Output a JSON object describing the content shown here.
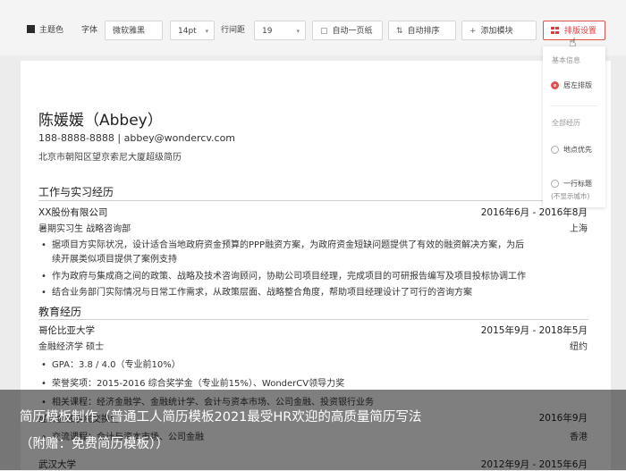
{
  "toolbar": {
    "theme_color": "主题色",
    "font_label": "字体",
    "font_value": "微软雅黑",
    "size_value": "14pt",
    "spacing_label": "行间距",
    "spacing_value": "19",
    "auto_page": "自动一页纸",
    "auto_sort": "自动排序",
    "add_module": "添加模块",
    "layout_settings": "排版设置"
  },
  "layout_panel": {
    "basic_info": "基本信息",
    "left_align": "居左排版",
    "all_experience": "全部经历",
    "location_first": "地点优先",
    "one_line_title": "一行标题",
    "not_show_city": "(不显示城市)"
  },
  "resume": {
    "name": "陈媛媛（Abbey）",
    "contact": "188-8888-8888 | abbey@wondercv.com",
    "address": "北京市朝阳区望京索尼大厦超级简历",
    "work_section": "工作与实习经历",
    "work": {
      "company": "XX股份有限公司",
      "date": "2016年6月 - 2016年8月",
      "role": "暑期实习生  战略咨询部",
      "city": "上海",
      "bullets": [
        "据项目方实际状况，设计适合当地政府资金预算的PPP融资方案，为政府资金短缺问题提供了有效的融资解决方案，为后",
        "续开展类似项目提供了案例支持",
        "作为政府与集成商之间的政策、战略及技术咨询顾问，协助公司项目经理，完成项目的可研报告编写及项目投标协调工作",
        "结合业务部门实际情况与日常工作需求，从政策层面、战略整合角度，帮助项目经理设计了可行的咨询方案"
      ]
    },
    "edu_section": "教育经历",
    "edu": {
      "school": "哥伦比亚大学",
      "date": "2015年9月 - 2018年5月",
      "degree": "金融经济学  硕士",
      "city": "纽约",
      "bullets": [
        "GPA：3.8 / 4.0（专业前10%）",
        "荣誉奖项：2015-2016 综合奖学金（专业前15%）、WonderCV领导力奖",
        "相关课程：经济金融学、金融统计学、会计与资本市场、公司金融、投资银行业务"
      ],
      "partial_line_1": "经济金融学院交换生",
      "partial_date": "2016年9月",
      "partial_city": "香港",
      "partial_line_2": "交流课程：会计与资本市场、公司金融",
      "partial_school": "武汉大学",
      "partial_date_2": "2012年9月 - 2015年6月"
    }
  },
  "caption": {
    "line1": "简历模板制作（普通工人简历模板2021最受HR欢迎的高质量简历写法",
    "line2": "（附赠：免费简历模板））"
  }
}
